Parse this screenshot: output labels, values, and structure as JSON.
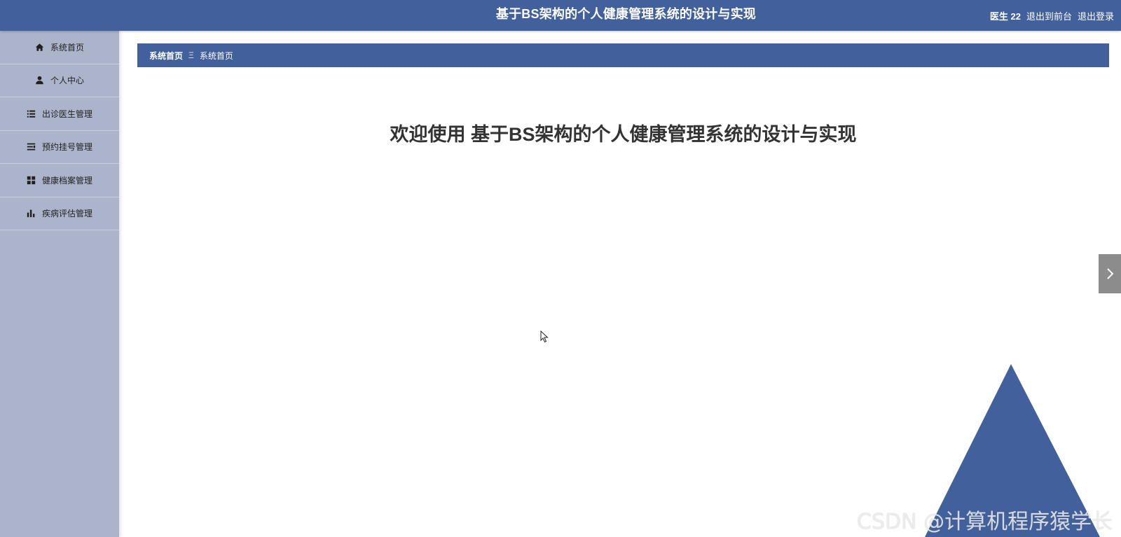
{
  "header": {
    "title": "基于BS架构的个人健康管理系统的设计与实现",
    "user": "医生 22",
    "front_link": "退出到前台",
    "logout_link": "退出登录"
  },
  "sidebar": {
    "items": [
      {
        "label": "系统首页",
        "icon": "home-icon"
      },
      {
        "label": "个人中心",
        "icon": "person-icon"
      },
      {
        "label": "出诊医生管理",
        "icon": "list-icon"
      },
      {
        "label": "预约挂号管理",
        "icon": "sliders-icon"
      },
      {
        "label": "健康档案管理",
        "icon": "grid-icon"
      },
      {
        "label": "疾病评估管理",
        "icon": "bar-chart-icon"
      }
    ]
  },
  "breadcrumb": {
    "first": "系统首页",
    "separator": "Ξ",
    "current": "系统首页"
  },
  "main": {
    "welcome": "欢迎使用 基于BS架构的个人健康管理系统的设计与实现"
  },
  "watermark": "CSDN @计算机程序猿学长",
  "colors": {
    "primary": "#41609c",
    "sidebar_bg": "#abb4ca",
    "side_tab": "#8c8c8c"
  }
}
